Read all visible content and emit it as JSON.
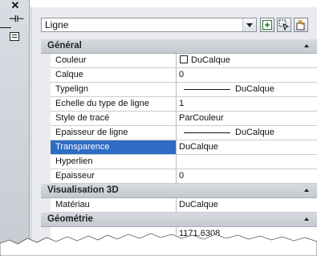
{
  "header": {
    "object_type": "Ligne"
  },
  "toolbar": {
    "toggle_pickadd_icon": "toggle-pickadd-icon",
    "select_objects_icon": "select-objects-icon",
    "quick_select_icon": "quick-select-icon"
  },
  "sections": [
    {
      "title": "Général",
      "rows": [
        {
          "label": "Couleur",
          "value": "DuCalque",
          "swatch": true
        },
        {
          "label": "Calque",
          "value": "0"
        },
        {
          "label": "Typelign",
          "value": "DuCalque",
          "linesample": true
        },
        {
          "label": "Echelle du type de ligne",
          "value": "1"
        },
        {
          "label": "Style de tracé",
          "value": "ParCouleur"
        },
        {
          "label": "Epaisseur de ligne",
          "value": "DuCalque",
          "linesample": true
        },
        {
          "label": "Transparence",
          "value": "DuCalque",
          "selected": true
        },
        {
          "label": "Hyperlien",
          "value": ""
        },
        {
          "label": "Epaisseur",
          "value": "0"
        }
      ]
    },
    {
      "title": "Visualisation 3D",
      "rows": [
        {
          "label": "Matériau",
          "value": "DuCalque"
        }
      ]
    },
    {
      "title": "Géométrie",
      "rows": [
        {
          "label": "",
          "value": "1171.6308"
        }
      ]
    }
  ],
  "colors": {
    "selection": "#2f6cc4",
    "section_bg": "#cfd3d8",
    "panel_bg": "#e9ebee"
  }
}
